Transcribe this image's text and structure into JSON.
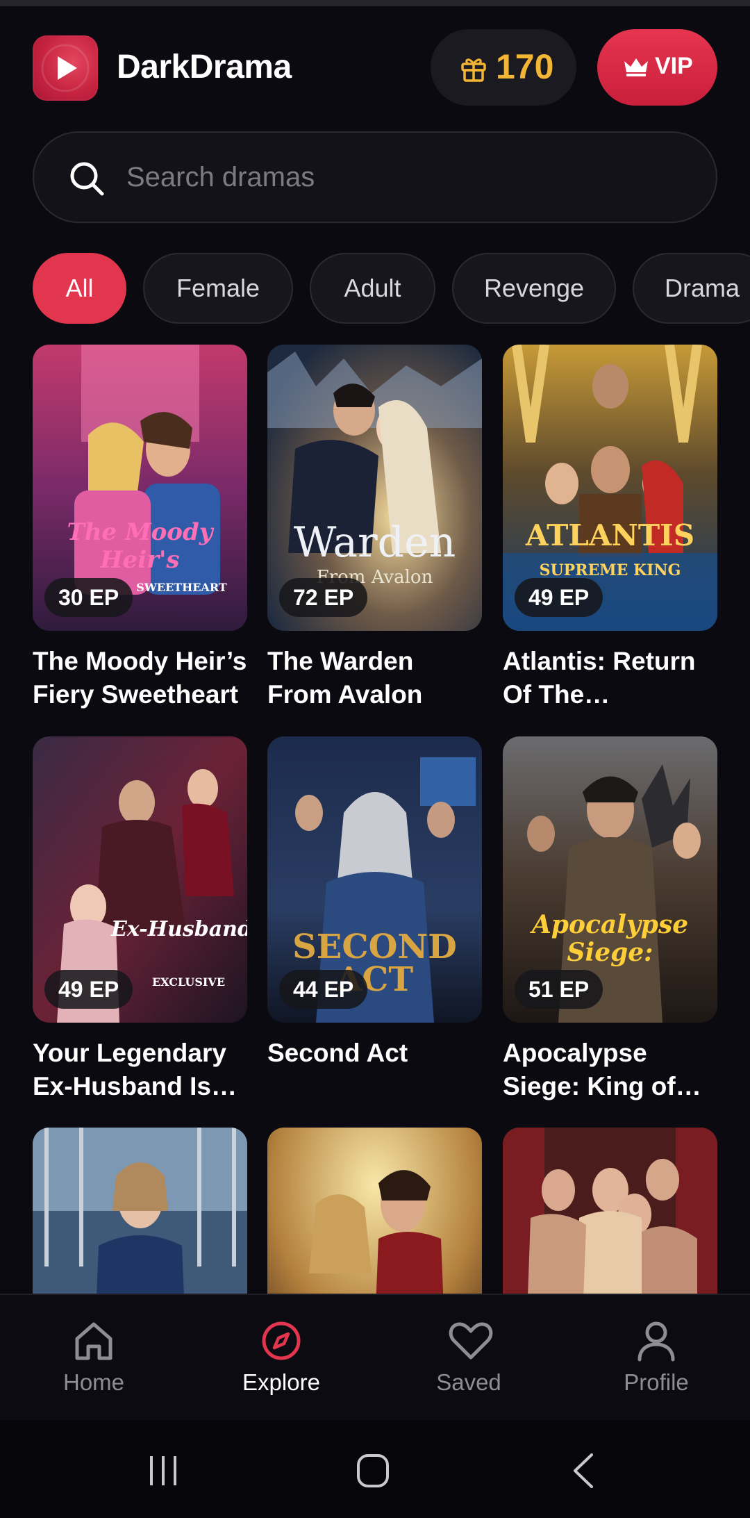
{
  "app": {
    "name": "DarkDrama"
  },
  "header": {
    "coins": "170",
    "vip_label": "VIP"
  },
  "search": {
    "placeholder": "Search dramas"
  },
  "categories": [
    "All",
    "Female",
    "Adult",
    "Revenge",
    "Drama"
  ],
  "active_category": "All",
  "dramas": [
    {
      "title": "The Moody Heir’s Fiery Sweetheart",
      "episodes": "30 EP",
      "poster_text": "The Moody Heir's",
      "poster_subtext": "SWEETHEART"
    },
    {
      "title": "The Warden From Avalon",
      "episodes": "72 EP",
      "poster_text": "Warden",
      "poster_subtext": "From Avalon"
    },
    {
      "title": "Atlantis: Return Of The Supreme…",
      "episodes": "49 EP",
      "poster_text": "ATLANTIS",
      "poster_subtext": "SUPREME KING"
    },
    {
      "title": "Your Legendary Ex-Husband Is…",
      "episodes": "49 EP",
      "poster_text": "Ex-Husband",
      "poster_subtext": "EXCLUSIVE"
    },
    {
      "title": "Second Act",
      "episodes": "44 EP",
      "poster_text": "SECOND",
      "poster_subtext": "ACT"
    },
    {
      "title": "Apocalypse Siege: King of th…",
      "episodes": "51 EP",
      "poster_text": "Apocalypse",
      "poster_subtext": "Siege:"
    },
    {
      "title": "",
      "episodes": ""
    },
    {
      "title": "",
      "episodes": ""
    },
    {
      "title": "",
      "episodes": ""
    }
  ],
  "bottom_nav": [
    {
      "label": "Home",
      "icon": "home-icon"
    },
    {
      "label": "Explore",
      "icon": "compass-icon"
    },
    {
      "label": "Saved",
      "icon": "heart-icon"
    },
    {
      "label": "Profile",
      "icon": "user-icon"
    }
  ],
  "active_nav": "Explore",
  "colors": {
    "accent": "#e2364f",
    "coin": "#f3b634",
    "background": "#0b0a10"
  }
}
